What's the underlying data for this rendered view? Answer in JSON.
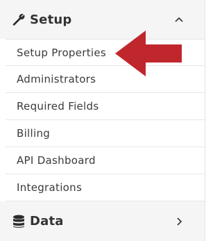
{
  "sidebar": {
    "setup": {
      "title": "Setup",
      "icon": "wrench-icon",
      "expanded": true,
      "items": [
        {
          "label": "Setup Properties"
        },
        {
          "label": "Administrators"
        },
        {
          "label": "Required Fields"
        },
        {
          "label": "Billing"
        },
        {
          "label": "API Dashboard"
        },
        {
          "label": "Integrations"
        }
      ]
    },
    "data": {
      "title": "Data",
      "icon": "database-icon",
      "expanded": false
    }
  },
  "annotation": {
    "arrow_color": "#c0272d",
    "points_to": "Setup Properties"
  }
}
